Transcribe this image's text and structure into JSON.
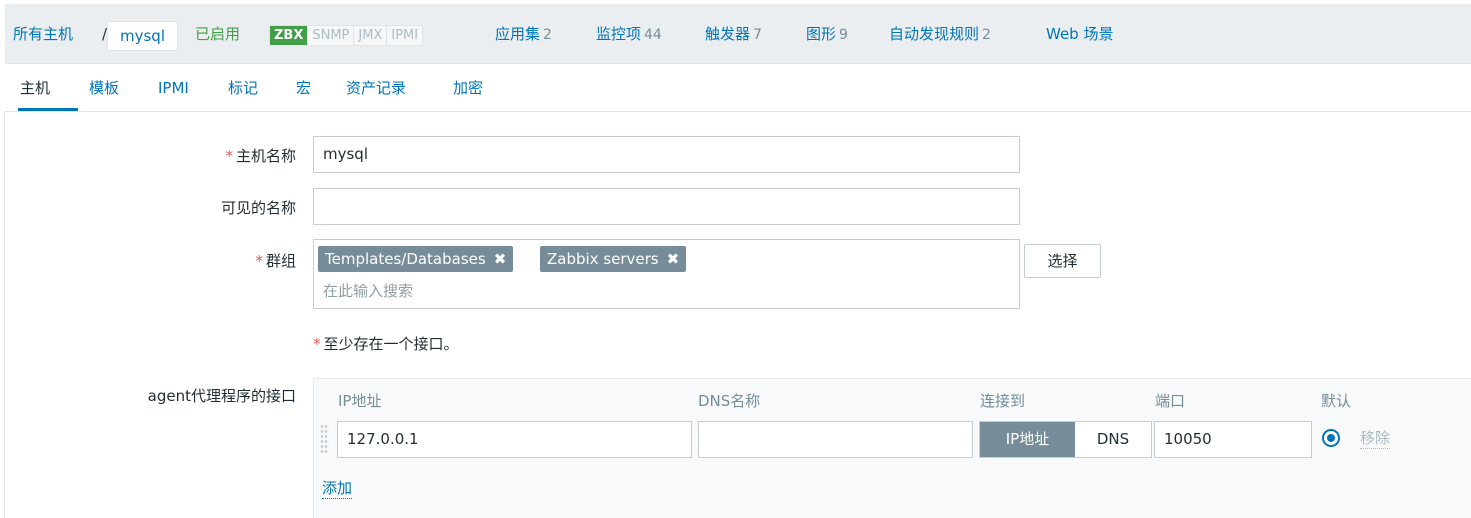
{
  "breadcrumb": {
    "all_hosts": "所有主机",
    "separator": "/",
    "current": "mysql"
  },
  "status": "已启用",
  "availability": [
    "ZBX",
    "SNMP",
    "JMX",
    "IPMI"
  ],
  "nav": [
    {
      "label": "应用集",
      "count": "2"
    },
    {
      "label": "监控项",
      "count": "44"
    },
    {
      "label": "触发器",
      "count": "7"
    },
    {
      "label": "图形",
      "count": "9"
    },
    {
      "label": "自动发现规则",
      "count": "2"
    },
    {
      "label": "Web 场景",
      "count": ""
    }
  ],
  "tabs": [
    "主机",
    "模板",
    "IPMI",
    "标记",
    "宏",
    "资产记录",
    "加密"
  ],
  "form": {
    "host_name": {
      "label": "主机名称",
      "value": "mysql"
    },
    "visible_name": {
      "label": "可见的名称",
      "value": ""
    },
    "groups": {
      "label": "群组",
      "chips": [
        "Templates/Databases",
        "Zabbix servers"
      ],
      "placeholder": "在此输入搜索",
      "select_button": "选择"
    },
    "note": "至少存在一个接口。",
    "agent_interface": {
      "label": "agent代理程序的接口",
      "columns": [
        "IP地址",
        "DNS名称",
        "连接到",
        "端口",
        "默认"
      ],
      "ip": "127.0.0.1",
      "dns": "",
      "connect_options": [
        "IP地址",
        "DNS"
      ],
      "port": "10050",
      "remove": "移除",
      "add": "添加"
    }
  },
  "colors": {
    "accent": "#0275b8",
    "enabled": "#429e47",
    "chip": "#768d99",
    "required": "#e45959"
  },
  "icons": {
    "chip_remove": "close-icon",
    "drag": "drag-handle-icon",
    "default_radio": "radio-checked-icon"
  }
}
